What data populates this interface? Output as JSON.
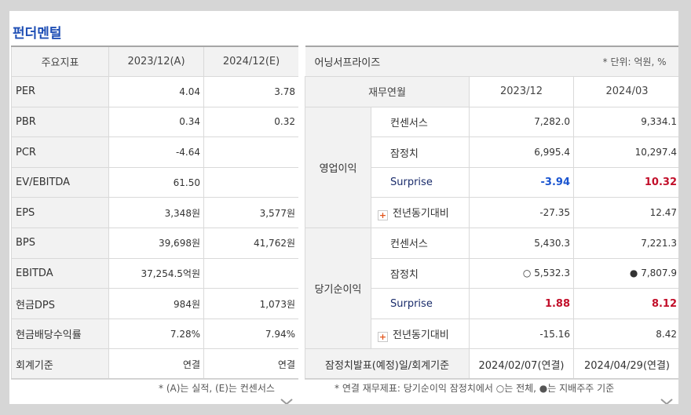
{
  "title": "펀더멘털",
  "fundamentals": {
    "headers": [
      "주요지표",
      "2023/12(A)",
      "2024/12(E)"
    ],
    "rows": [
      {
        "label": "PER",
        "v1": "4.04",
        "v2": "3.78"
      },
      {
        "label": "PBR",
        "v1": "0.34",
        "v2": "0.32"
      },
      {
        "label": "PCR",
        "v1": "-4.64",
        "v2": ""
      },
      {
        "label": "EV/EBITDA",
        "v1": "61.50",
        "v2": ""
      },
      {
        "label": "EPS",
        "v1": "3,348원",
        "v2": "3,577원"
      },
      {
        "label": "BPS",
        "v1": "39,698원",
        "v2": "41,762원"
      },
      {
        "label": "EBITDA",
        "v1": "37,254.5억원",
        "v2": ""
      },
      {
        "label": "현금DPS",
        "v1": "984원",
        "v2": "1,073원"
      },
      {
        "label": "현금배당수익률",
        "v1": "7.28%",
        "v2": "7.94%"
      },
      {
        "label": "회계기준",
        "v1": "연결",
        "v2": "연결"
      }
    ],
    "note": "* (A)는 실적, (E)는 컨센서스"
  },
  "earnings": {
    "title": "어닝서프라이즈",
    "unit": "* 단위: 억원, %",
    "headers": [
      "재무연월",
      "2023/12",
      "2024/03"
    ],
    "groups": [
      {
        "name": "영업이익",
        "rows": [
          {
            "label": "컨센서스",
            "v1": "7,282.0",
            "v2": "9,334.1"
          },
          {
            "label": "잠정치",
            "v1": "6,995.4",
            "v2": "10,297.4"
          },
          {
            "label": "Surprise",
            "v1": "-3.94",
            "v2": "10.32"
          },
          {
            "label": "전년동기대비",
            "v1": "-27.35",
            "v2": "12.47"
          }
        ]
      },
      {
        "name": "당기순이익",
        "rows": [
          {
            "label": "컨센서스",
            "v1": "5,430.3",
            "v2": "7,221.3"
          },
          {
            "label": "잠정치",
            "v1": "○ 5,532.3",
            "v2": "● 7,807.9"
          },
          {
            "label": "Surprise",
            "v1": "1.88",
            "v2": "8.12"
          },
          {
            "label": "전년동기대비",
            "v1": "-15.16",
            "v2": "8.42"
          }
        ]
      }
    ],
    "footer": {
      "label": "잠정치발표(예정)일/회계기준",
      "v1": "2024/02/07(연결)",
      "v2": "2024/04/29(연결)"
    },
    "note": "* 연결 재무제표: 당기순이익 잠정치에서 ○는 전체, ●는 지배주주 기준"
  },
  "colors": {
    "title": "#1f4fb5",
    "negative": "#1b55d0",
    "positive": "#c20f2a"
  },
  "icons": {
    "expand": "chevron-down-icon",
    "yoy": "plus-icon"
  }
}
